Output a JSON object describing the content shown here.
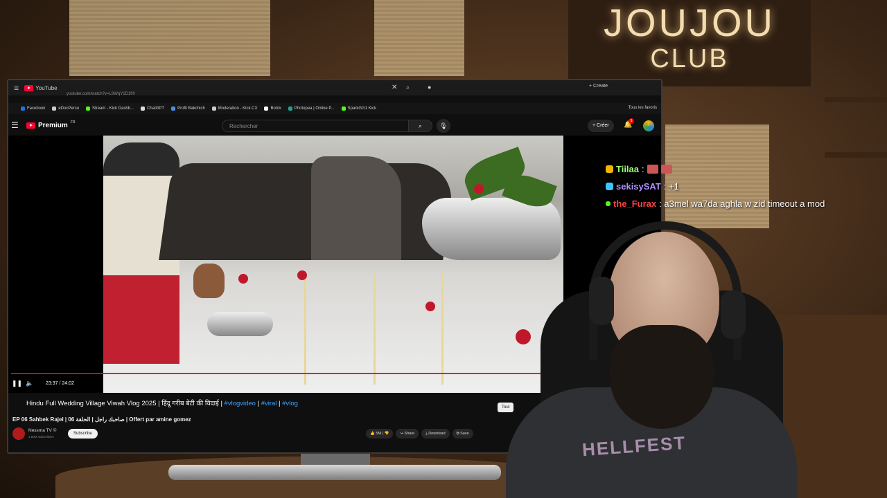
{
  "browser": {
    "tab_title": "YouTube",
    "url": "youtube.com/watch?v=L9WqY1D1fI0",
    "bookmarks": [
      {
        "label": "Facebook",
        "color": "#1877f2"
      },
      {
        "label": "eDocPerso",
        "color": "#cccccc"
      },
      {
        "label": "Stream - Kick Dashb...",
        "color": "#53fc18"
      },
      {
        "label": "ChatGPT",
        "color": "#dddddd"
      },
      {
        "label": "Profil Bakchich",
        "color": "#4a90e2"
      },
      {
        "label": "Moderation - Kick.CX",
        "color": "#cccccc"
      },
      {
        "label": "Botrix",
        "color": "#ffffff"
      },
      {
        "label": "Photopea | Online P...",
        "color": "#18a497"
      },
      {
        "label": "SparkGG1 Kick",
        "color": "#53fc18"
      }
    ],
    "all_bookmarks": "Tous les favoris",
    "create_label": "Create"
  },
  "youtube": {
    "logo_text": "Premium",
    "region": "FR",
    "search_placeholder": "Rechercher",
    "create_label": "Créer",
    "notif_count": "9",
    "player": {
      "time": "23:37 / 24:02",
      "progress": 0.82
    },
    "video": {
      "title_main": "Hindu Full Wedding Village Viwah Vlog 2025 | हिंदू गरीब बेटी की विदाई | ",
      "hashtags": [
        "#vlogvideo",
        "#viral",
        "#vlog"
      ],
      "sep": " | ",
      "ticker": "EP 06 Sahbek Rajel | صاحبك راجل | الحلقة 06 | Offert par amine gomez",
      "channel": "Nessma TV ©",
      "subscribers": "1.60M subscribers",
      "subscribe_label": "Subscribe",
      "likes": "5M",
      "share": "Share",
      "download": "Download",
      "save": "Save",
      "tout_label": "Tout"
    }
  },
  "overlay": {
    "sign_line1": "JOUJOU",
    "sign_line2": "CLUB",
    "chat": [
      {
        "user": "Tiilaa",
        "user_color": "#9aff7a",
        "message": ":",
        "badge_color": "#f4b400"
      },
      {
        "user": "sekisySAT",
        "user_color": "#b090ff",
        "message": ": +1",
        "badge_color": "#3ec3ff"
      },
      {
        "user": "the_Furax",
        "user_color": "#ff4040",
        "message": ": a3mel wa7da aghla w zid timeout a mod",
        "badge_color": "#53fc18"
      }
    ],
    "shirt_text": "HELLFEST"
  }
}
